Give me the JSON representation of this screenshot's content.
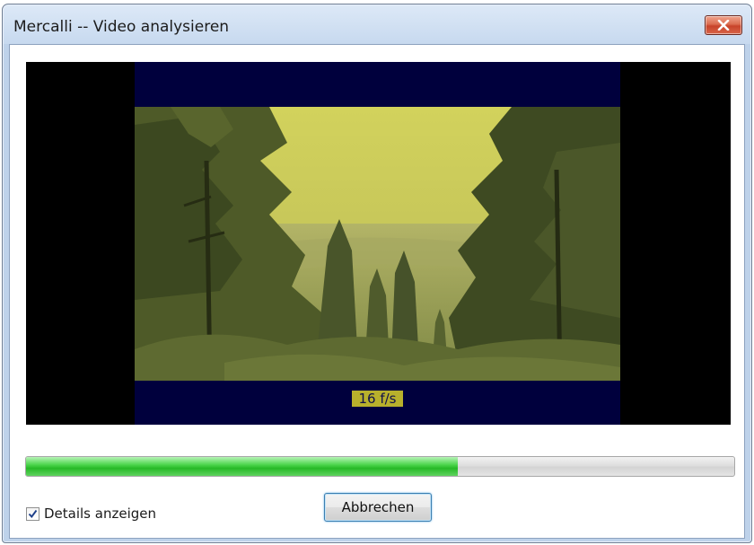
{
  "window": {
    "title": "Mercalli -- Video analysieren"
  },
  "video": {
    "fps_label": "16 f/s"
  },
  "progress": {
    "fraction": 0.61,
    "color": "#2fbf2f"
  },
  "details_checkbox": {
    "label": "Details anzeigen",
    "checked": true
  },
  "cancel_button": {
    "label": "Abbrechen"
  },
  "colors": {
    "close_button": "#c8432a",
    "video_letterbox": "#00003d",
    "fps_badge": "#b8b02c"
  }
}
